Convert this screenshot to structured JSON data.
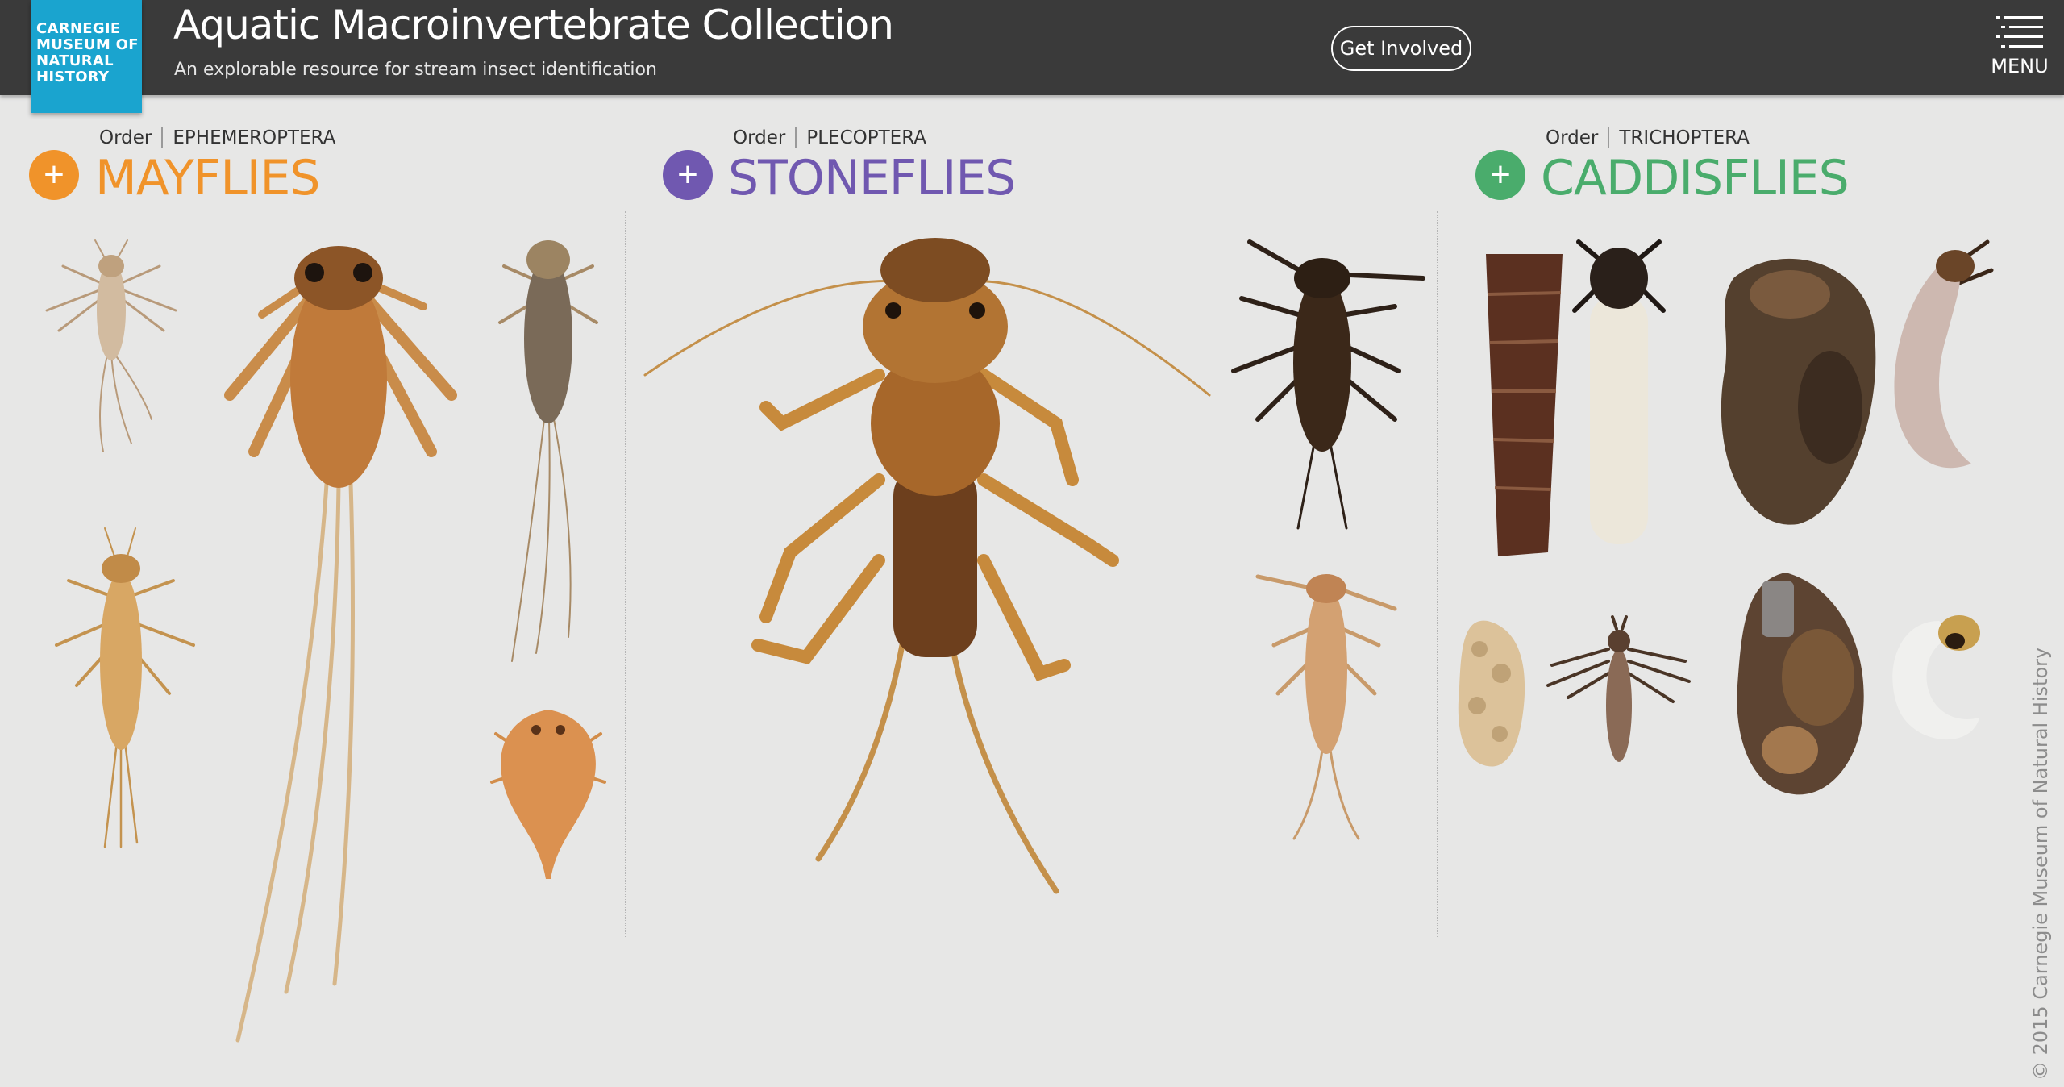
{
  "header": {
    "logo": {
      "lines": [
        "CARNEGIE",
        "MUSEUM OF",
        "NATURAL",
        "HISTORY"
      ],
      "color": "#1aa4cf"
    },
    "title": "Aquatic Macroinvertebrate Collection",
    "subtitle": "An explorable resource for stream insect identification",
    "cta_label": "Get Involved",
    "menu_label": "MENU",
    "menu_icon": "list-menu-icon",
    "background": "#3a3a3a"
  },
  "sections": [
    {
      "order_key": "Order",
      "order_value": "EPHEMEROPTERA",
      "title": "MAYFLIES",
      "color": "#f0932a",
      "add_icon": "plus-icon",
      "specimens": [
        "mayfly-nymph",
        "mayfly-nymph",
        "mayfly-nymph",
        "mayfly-nymph",
        "mayfly-nymph"
      ]
    },
    {
      "order_key": "Order",
      "order_value": "PLECOPTERA",
      "title": "STONEFLIES",
      "color": "#7058b0",
      "add_icon": "plus-icon",
      "specimens": [
        "stonefly-nymph",
        "stonefly-nymph",
        "stonefly-nymph"
      ]
    },
    {
      "order_key": "Order",
      "order_value": "TRICHOPTERA",
      "title": "CADDISFLIES",
      "color": "#4aac6c",
      "add_icon": "plus-icon",
      "specimens": [
        "caddisfly-case",
        "caddisfly-larva",
        "caddisfly-case",
        "caddisfly-larva",
        "caddisfly-case",
        "caddisfly-larva",
        "caddisfly-case",
        "caddisfly-larva"
      ]
    }
  ],
  "footer": {
    "copyright": "© 2015 Carnegie Museum of Natural History"
  }
}
